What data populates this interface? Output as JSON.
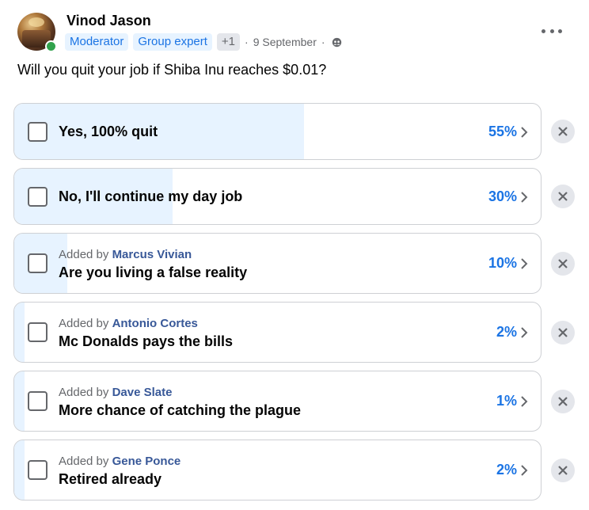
{
  "post": {
    "author": "Vinod Jason",
    "badges": [
      "Moderator",
      "Group expert"
    ],
    "extra_badges": "+1",
    "date": "9 September",
    "separator": "·",
    "audience_icon": "group-icon",
    "question": "Will you quit your job if Shiba Inu reaches $0.01?"
  },
  "poll": {
    "added_prefix": "Added by",
    "options": [
      {
        "label": "Yes, 100% quit",
        "percent_label": "55%",
        "percent": 55,
        "added_by": ""
      },
      {
        "label": "No, I'll continue my day job",
        "percent_label": "30%",
        "percent": 30,
        "added_by": ""
      },
      {
        "label": "Are you living a false reality",
        "percent_label": "10%",
        "percent": 10,
        "added_by": "Marcus Vivian"
      },
      {
        "label": "Mc Donalds pays the bills",
        "percent_label": "2%",
        "percent": 2,
        "added_by": "Antonio Cortes"
      },
      {
        "label": "More chance of catching the plague",
        "percent_label": "1%",
        "percent": 1,
        "added_by": "Dave Slate"
      },
      {
        "label": "Retired already",
        "percent_label": "2%",
        "percent": 2,
        "added_by": "Gene Ponce"
      }
    ]
  },
  "colors": {
    "accent": "#1b74e4",
    "fill": "#e7f3ff",
    "online": "#31a24c"
  },
  "icons": {
    "more": "more-options-icon",
    "chevron": "chevron-right-icon",
    "remove": "close-icon"
  }
}
